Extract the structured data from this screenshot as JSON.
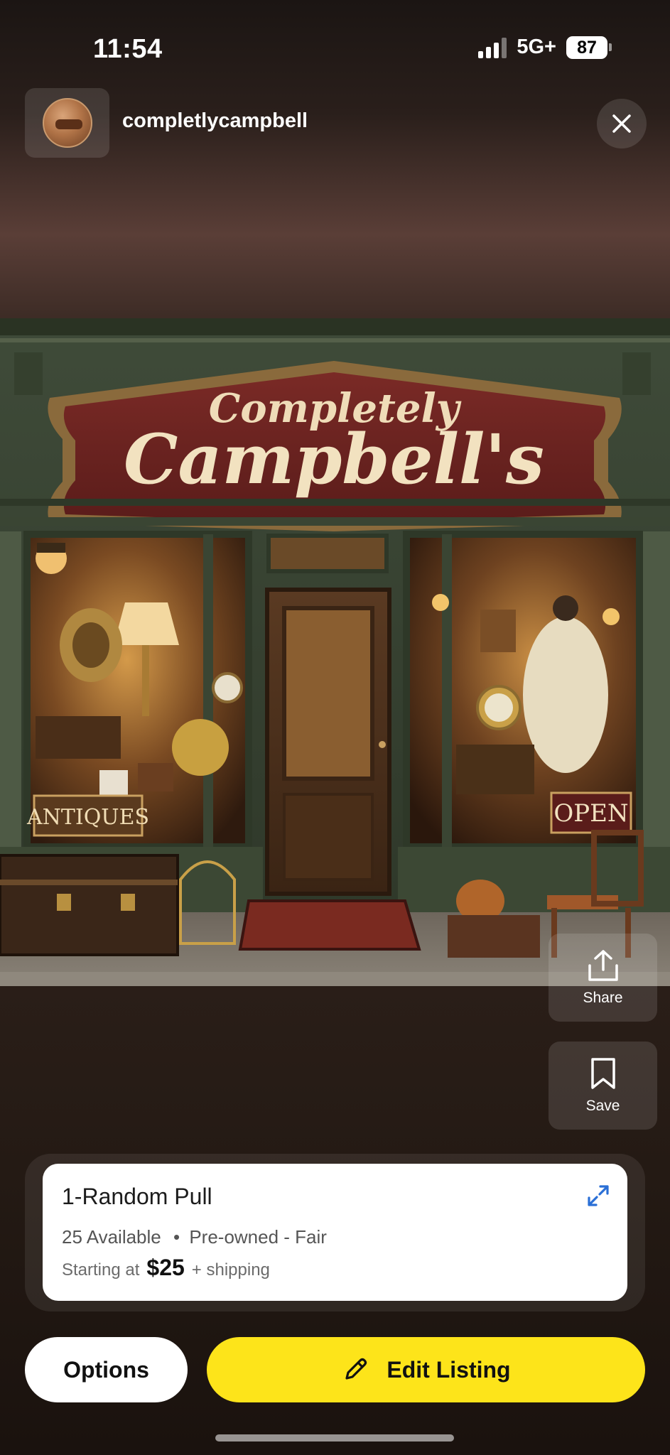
{
  "status_bar": {
    "time": "11:54",
    "network": "5G+",
    "battery": "87"
  },
  "header": {
    "username": "completlycampbell",
    "avatar_icon": "shop-avatar-icon",
    "close_icon": "close-icon"
  },
  "hero_image": {
    "sign_line1": "Completely",
    "sign_line2": "Campbell's",
    "left_sign": "ANTIQUES",
    "right_sign": "OPEN"
  },
  "actions": {
    "share_label": "Share",
    "save_label": "Save"
  },
  "listing": {
    "title": "1-Random Pull",
    "available": "25 Available",
    "bullet": "•",
    "condition": "Pre-owned - Fair",
    "starting_label": "Starting at",
    "price": "$25",
    "shipping": "+ shipping",
    "accent_color": "#2a6fd6"
  },
  "footer": {
    "options_label": "Options",
    "edit_label": "Edit Listing",
    "edit_color": "#fde41a"
  }
}
